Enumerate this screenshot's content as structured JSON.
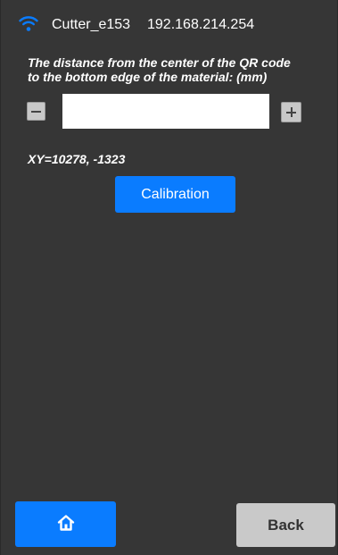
{
  "status_bar": {
    "wifi_icon": "wifi-icon",
    "device_name": "Cutter_e153",
    "ip_address": "192.168.214.254",
    "accent_color": "#0a7cff"
  },
  "calibration_panel": {
    "instruction": "The distance from the center of the QR code\nto the bottom edge of the material: (mm)",
    "distance_input": {
      "value": "",
      "placeholder": ""
    },
    "decrement_icon": "minus-icon",
    "increment_icon": "plus-icon",
    "xy_readout": "XY=10278, -1323",
    "calibration_label": "Calibration"
  },
  "footer": {
    "home_icon": "home-icon",
    "back_label": "Back"
  }
}
